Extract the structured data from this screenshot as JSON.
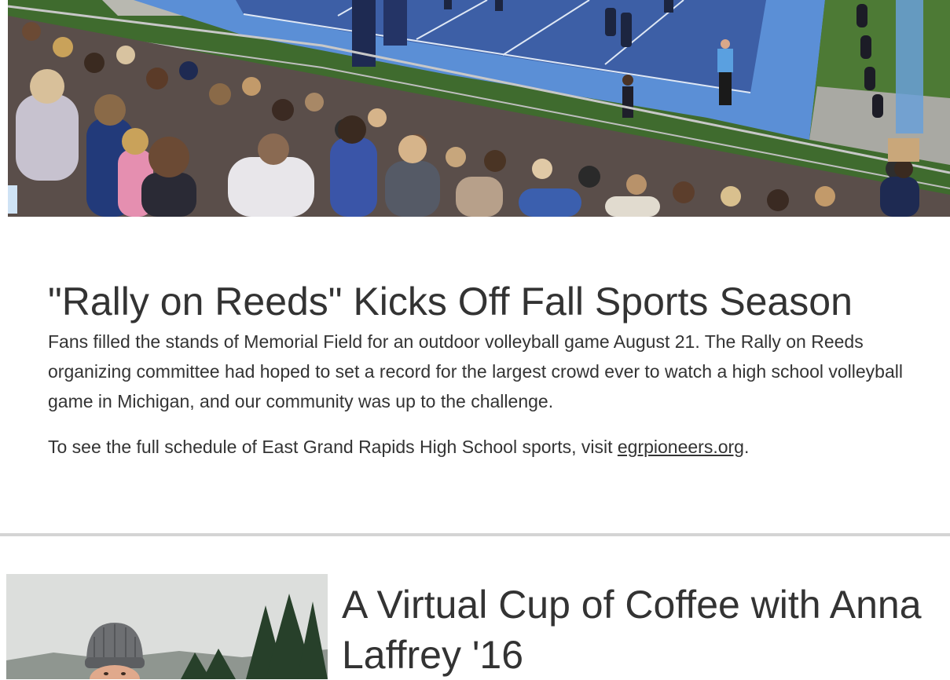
{
  "articles": [
    {
      "title": "\"Rally on Reeds\" Kicks Off Fall Sports Season",
      "paragraph1": "Fans filled the stands of Memorial Field for an outdoor volleyball game August 21. The Rally on Reeds organizing committee had hoped to set a record for the largest crowd ever to watch a high school volleyball game in Michigan, and our community was up to the challenge.",
      "paragraph2_prefix": "To see the full schedule of East Grand Rapids High School sports, visit ",
      "link_text": "egrpioneers.org",
      "paragraph2_suffix": "."
    },
    {
      "title": "A Virtual Cup of Coffee with Anna Laffrey '16"
    }
  ],
  "colors": {
    "court_inner": "#3d5fa6",
    "court_outer": "#5b8fd6",
    "grass": "#3f6b2e",
    "divider": "#d4d4d4",
    "text": "#333333"
  }
}
